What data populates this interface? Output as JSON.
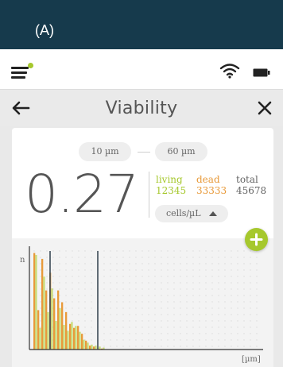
{
  "banner": {
    "label": "(A)"
  },
  "screen": {
    "title": "Viability",
    "size_range": {
      "min": "10 µm",
      "max": "60 µm"
    },
    "viability_value": "0.27",
    "counts": {
      "living_label": "living",
      "living_value": "12345",
      "dead_label": "dead",
      "dead_value": "33333",
      "total_label": "total",
      "total_value": "45678"
    },
    "unit": "cells/µL"
  },
  "icons": {
    "menu": "menu-icon",
    "notification": "notification-dot",
    "wifi": "wifi-icon",
    "battery": "battery-icon",
    "back": "back-arrow-icon",
    "close": "close-icon",
    "unit_caret": "caret-up-icon",
    "add": "plus-icon"
  },
  "colors": {
    "header": "#163a4c",
    "accent": "#a6c82d",
    "dead": "#e89a3a",
    "living": "#c8dc78",
    "marker": "#3b4a56"
  },
  "chart_data": {
    "type": "bar",
    "ylabel": "n",
    "xlabel": "[µm]",
    "grid": true,
    "range_markers": [
      "10",
      "60"
    ],
    "series": [
      {
        "name": "living",
        "values": [
          96,
          22,
          74,
          38,
          62,
          29,
          42,
          25,
          19,
          28,
          24,
          18,
          10,
          7,
          5,
          4,
          3,
          2
        ]
      },
      {
        "name": "dead",
        "values": [
          98,
          40,
          92,
          60,
          78,
          52,
          60,
          48,
          38,
          26,
          22,
          24,
          16,
          9,
          4,
          3,
          1,
          1
        ]
      }
    ]
  }
}
